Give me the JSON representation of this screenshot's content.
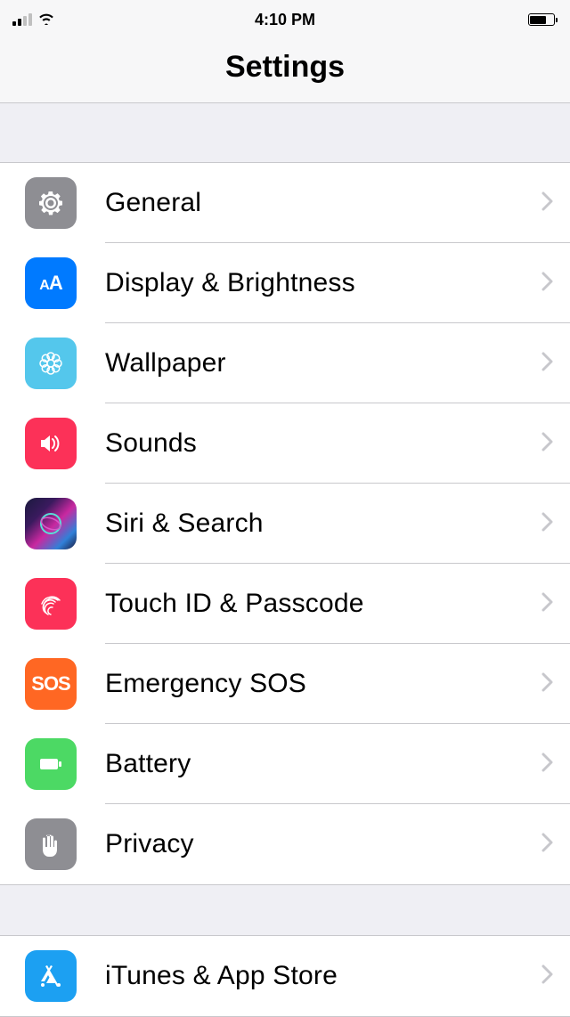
{
  "status": {
    "time": "4:10 PM"
  },
  "header": {
    "title": "Settings"
  },
  "section1": {
    "items": [
      {
        "label": "General",
        "name": "general"
      },
      {
        "label": "Display & Brightness",
        "name": "display-brightness"
      },
      {
        "label": "Wallpaper",
        "name": "wallpaper"
      },
      {
        "label": "Sounds",
        "name": "sounds"
      },
      {
        "label": "Siri & Search",
        "name": "siri-search"
      },
      {
        "label": "Touch ID & Passcode",
        "name": "touch-id-passcode"
      },
      {
        "label": "Emergency SOS",
        "name": "emergency-sos"
      },
      {
        "label": "Battery",
        "name": "battery"
      },
      {
        "label": "Privacy",
        "name": "privacy"
      }
    ]
  },
  "section2": {
    "items": [
      {
        "label": "iTunes & App Store",
        "name": "itunes-app-store"
      }
    ]
  },
  "iconText": {
    "aa_small": "A",
    "aa_large": "A",
    "sos": "SOS"
  }
}
